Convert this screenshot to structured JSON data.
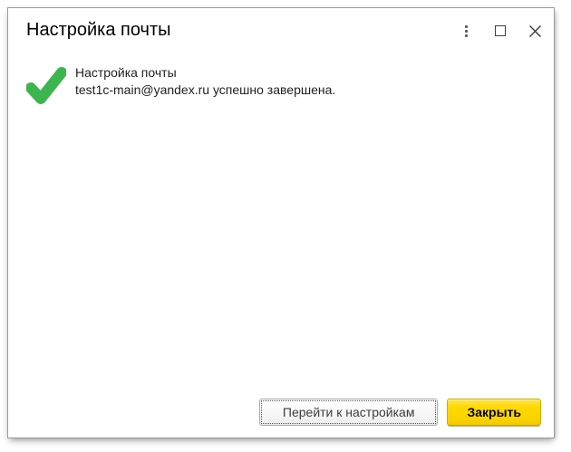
{
  "window": {
    "title": "Настройка почты"
  },
  "titlebar": {
    "icons": [
      "kebab-menu",
      "maximize",
      "close"
    ]
  },
  "message": {
    "status_icon": "success-checkmark",
    "line1": "Настройка почты",
    "line2": "test1c-main@yandex.ru успешно завершена."
  },
  "buttons": {
    "go_to_settings": "Перейти к настройкам",
    "close": "Закрыть"
  },
  "colors": {
    "success_green": "#3cb54e",
    "primary_yellow": "#fcd900",
    "window_border": "#9a9a9a",
    "icon_gray": "#3c3c3c"
  }
}
